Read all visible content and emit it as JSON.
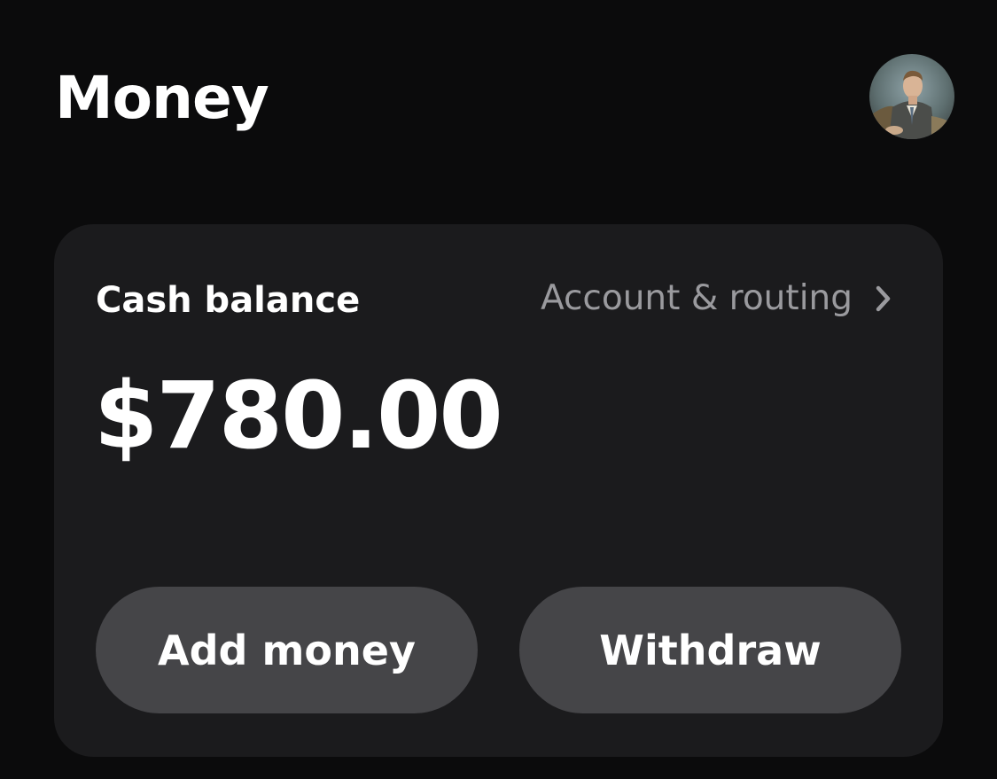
{
  "header": {
    "title": "Money"
  },
  "avatar": {
    "icon": "profile-photo"
  },
  "cash_card": {
    "label": "Cash balance",
    "account_link_label": "Account & routing",
    "balance": "$780.00",
    "actions": {
      "add_money": "Add money",
      "withdraw": "Withdraw"
    }
  },
  "colors": {
    "background": "#0b0b0c",
    "card": "#1b1b1d",
    "button": "#454548",
    "muted_text": "#9a9a9e"
  }
}
